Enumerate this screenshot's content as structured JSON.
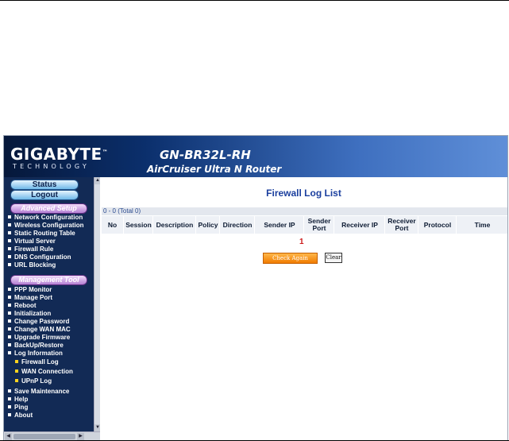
{
  "banner": {
    "logo": "GIGABYTE",
    "logo_tm": "™",
    "logo_sub": "TECHNOLOGY",
    "model": "GN-BR32L-RH",
    "router_name": "AirCruiser Ultra N Router"
  },
  "sidebar": {
    "status": "Status",
    "logout": "Logout",
    "advanced_header": "Advanced Setup",
    "advanced_items": [
      "Network Configuration",
      "Wireless Configuration",
      "Static Routing Table",
      "Virtual Server",
      "Firewall Rule",
      "DNS Configuration",
      "URL Blocking"
    ],
    "management_header": "Management Tool",
    "management_items": [
      "PPP Monitor",
      "Manage Port",
      "Reboot",
      "Initialization",
      "Change Password",
      "Change WAN MAC",
      "Upgrade Firmware",
      "BackUp/Restore",
      "Log Information"
    ],
    "log_subitems": [
      "Firewall Log",
      "WAN Connection",
      "UPnP Log"
    ],
    "bottom_items": [
      "Save Maintenance",
      "Help",
      "Ping",
      "About"
    ]
  },
  "main": {
    "title": "Firewall Log List",
    "summary": "0 - 0 (Total 0)",
    "columns": [
      "No",
      "Session",
      "Description",
      "Policy",
      "Direction",
      "Sender IP",
      "Sender Port",
      "Receiver IP",
      "Receiver Port",
      "Protocol",
      "Time"
    ],
    "page_number": "1",
    "check_again": "Check Again",
    "clear": "Clear"
  }
}
